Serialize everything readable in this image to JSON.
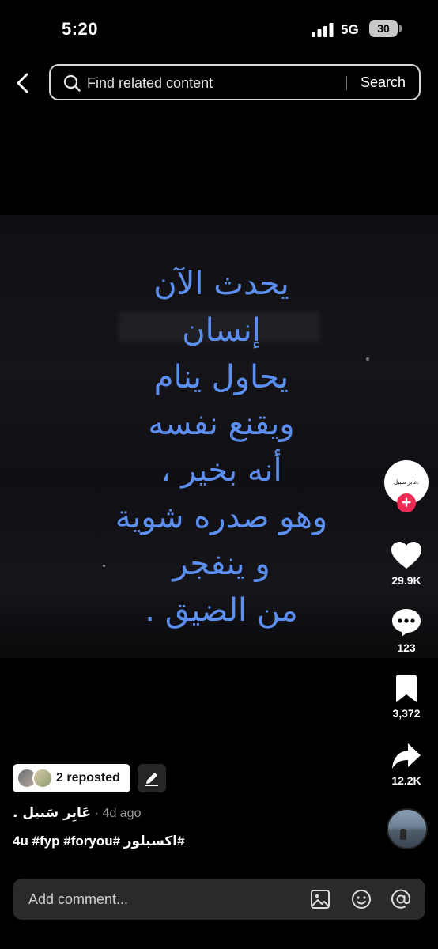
{
  "status_bar": {
    "time": "5:20",
    "network": "5G",
    "battery": "30"
  },
  "search": {
    "placeholder": "Find related content",
    "button_label": "Search"
  },
  "video": {
    "caption_lines": [
      "يحدث الآن",
      "إنسان",
      "يحاول ينام",
      "ويقنع نفسه",
      "أنه بخير ،",
      "وهو صدره شوية",
      "و ينفجر",
      "من الضيق ."
    ],
    "caption_color": "#5c8ff0"
  },
  "rail": {
    "creator_avatar_text": "عابر سبيل.",
    "follow_symbol": "+",
    "likes": "29.9K",
    "comments": "123",
    "saves": "3,372",
    "shares": "12.2K"
  },
  "post": {
    "repost_label": "2 reposted",
    "author": "عَابِر سَبيل .",
    "age": "· 4d ago",
    "hashtags": "4u #fyp #foryou# اكسبلور#"
  },
  "comment_bar": {
    "placeholder": "Add comment..."
  },
  "colors": {
    "accent_red": "#ee2a55",
    "background": "#000000"
  },
  "icons": [
    "signal-icon",
    "chevron-left-icon",
    "search-icon",
    "heart-icon",
    "comment-icon",
    "bookmark-icon",
    "share-icon",
    "pencil-icon",
    "image-icon",
    "emoji-icon",
    "mention-icon"
  ]
}
